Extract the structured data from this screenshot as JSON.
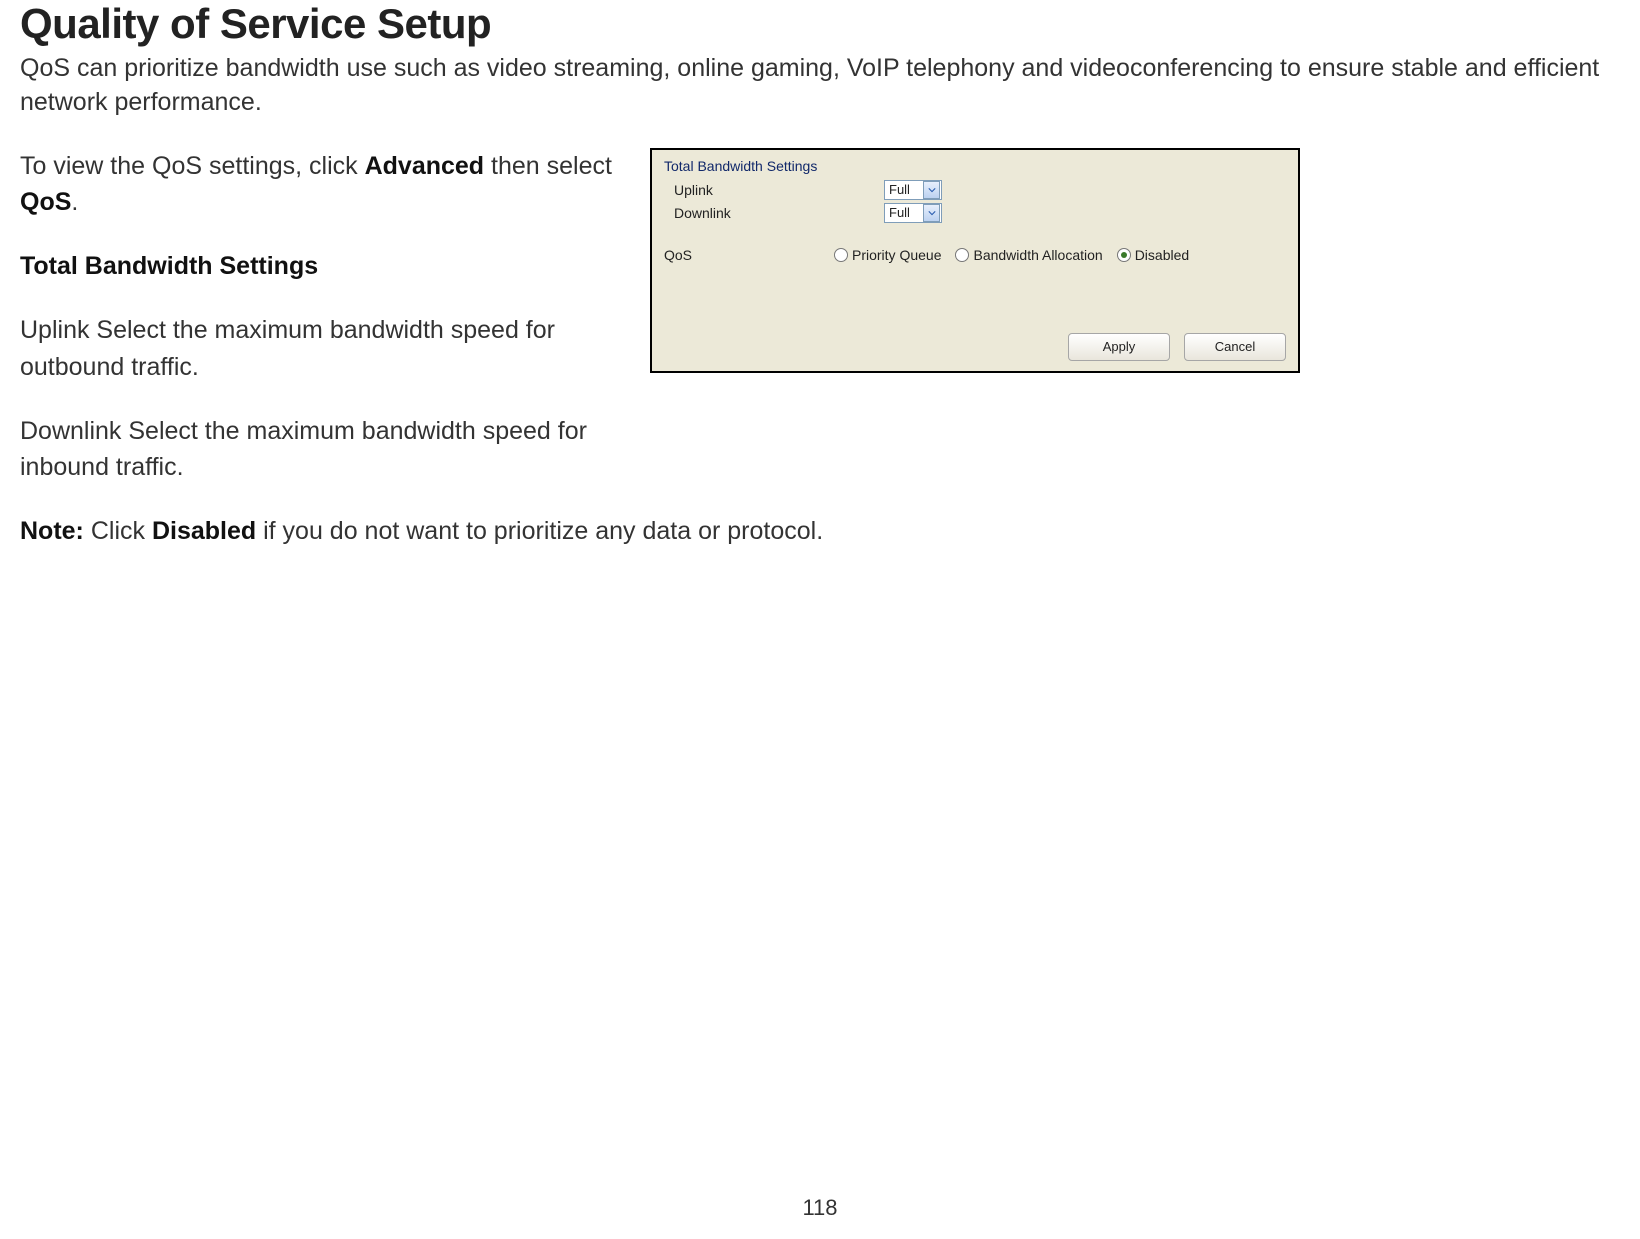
{
  "doc": {
    "title": "Quality of Service Setup",
    "intro": "QoS can prioritize bandwidth use such as video streaming, online gaming, VoIP telephony and videoconferencing to ensure stable and efficient network performance.",
    "instruction_prefix": "To view the QoS settings, click ",
    "instruction_bold1": "Advanced",
    "instruction_mid": " then select ",
    "instruction_bold2": "QoS",
    "instruction_suffix": ".",
    "section_heading": "Total Bandwidth Settings",
    "uplink_desc": "Uplink Select the maximum bandwidth speed for outbound traffic.",
    "downlink_desc": "Downlink Select the maximum bandwidth speed for inbound traffic.",
    "note_label": "Note:",
    "note_prefix": " Click ",
    "note_bold": "Disabled",
    "note_suffix": " if you do not want to prioritize any data or protocol.",
    "page_number": "118"
  },
  "panel": {
    "title": "Total Bandwidth Settings",
    "uplink_label": "Uplink",
    "uplink_value": "Full",
    "downlink_label": "Downlink",
    "downlink_value": "Full",
    "qos_label": "QoS",
    "radio_priority": "Priority Queue",
    "radio_bandwidth": "Bandwidth Allocation",
    "radio_disabled": "Disabled",
    "selected": "disabled",
    "apply": "Apply",
    "cancel": "Cancel"
  }
}
